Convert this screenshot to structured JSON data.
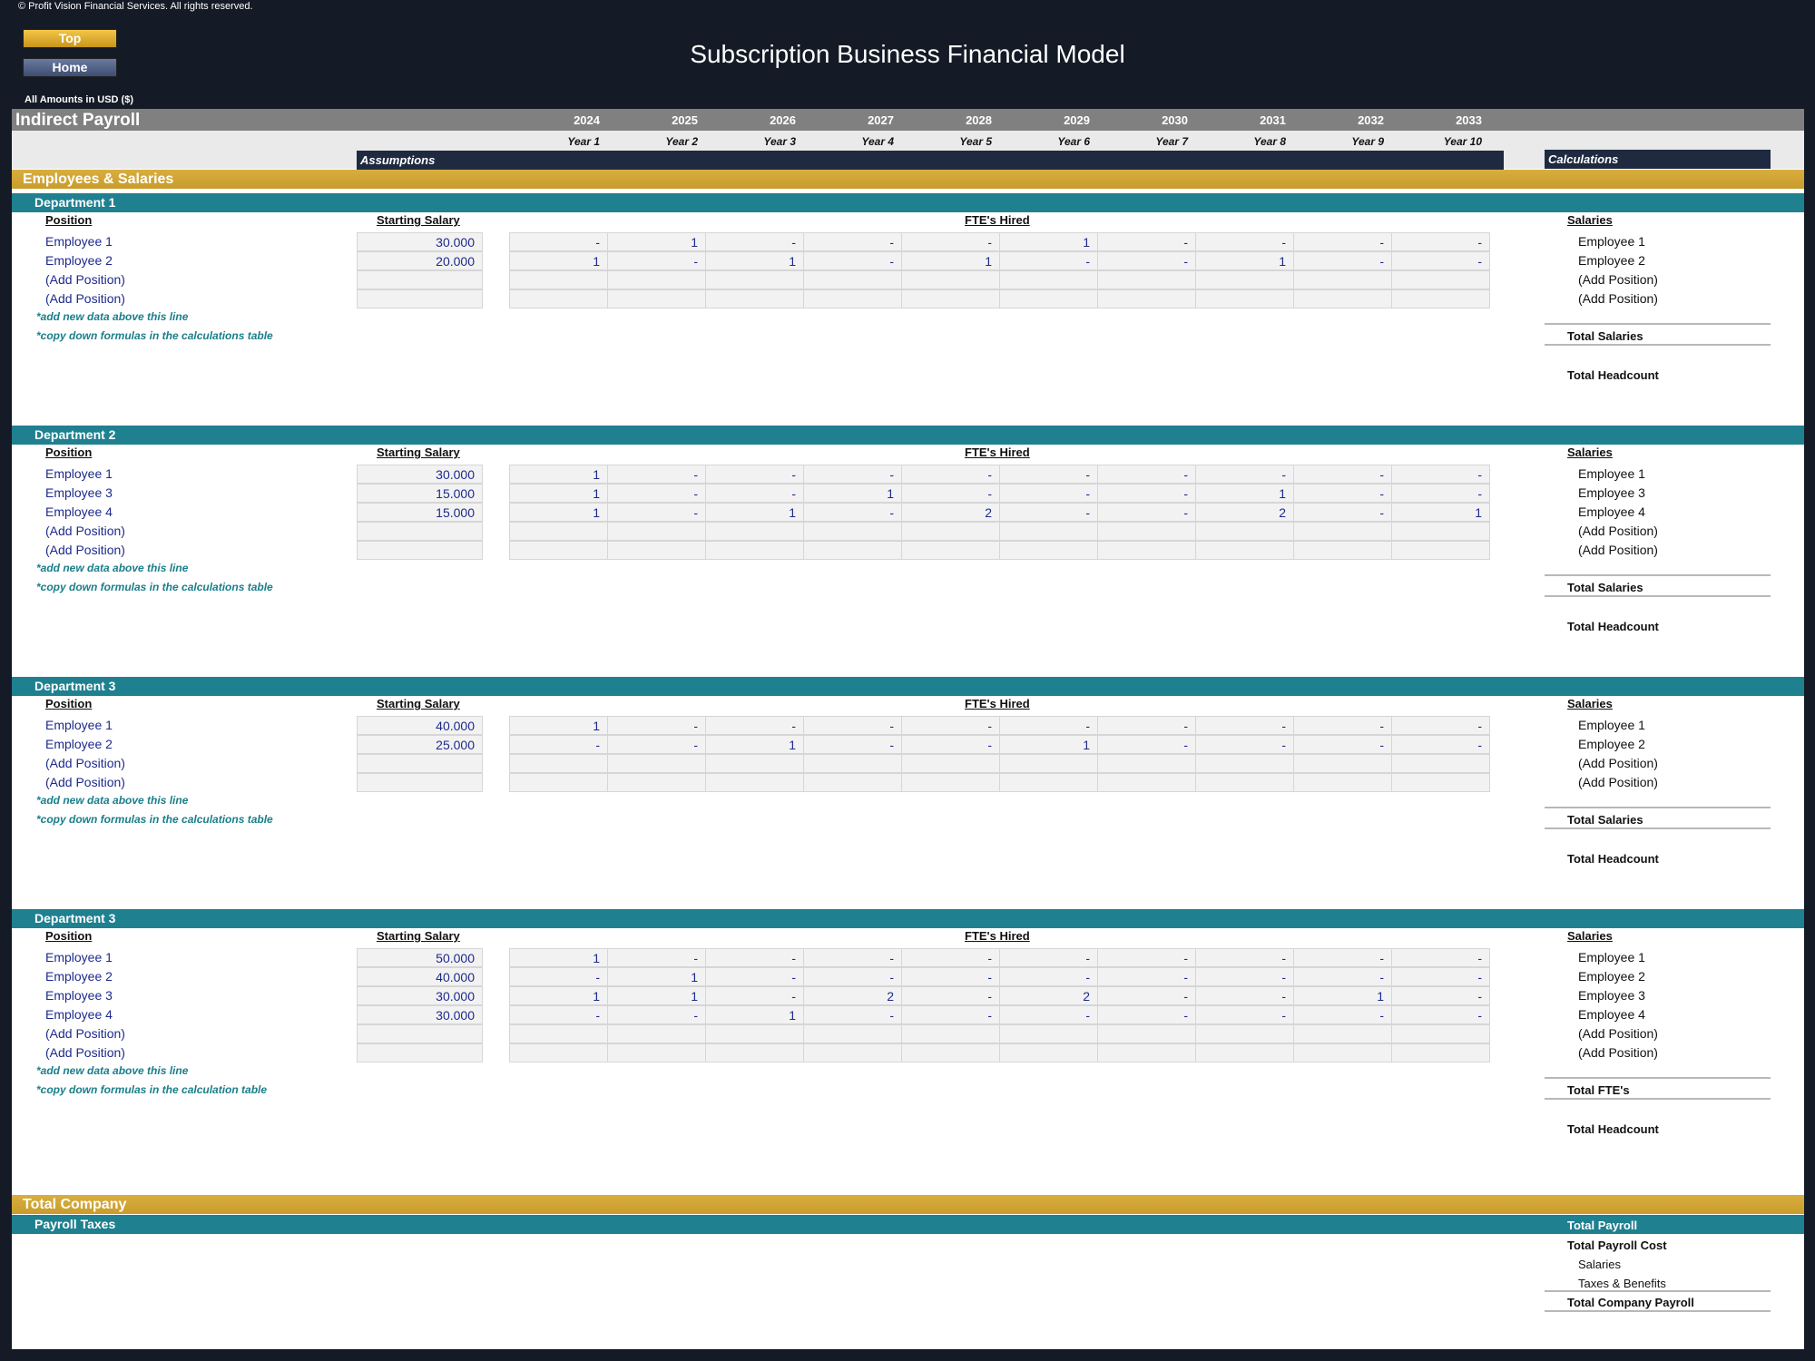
{
  "header": {
    "copyright": "© Profit Vision Financial Services. All rights reserved.",
    "top_button": "Top",
    "home_button": "Home",
    "title": "Subscription Business Financial Model",
    "amounts_label": "All Amounts in  USD ($)"
  },
  "sheet": {
    "title": "Indirect Payroll",
    "years": [
      "2024",
      "2025",
      "2026",
      "2027",
      "2028",
      "2029",
      "2030",
      "2031",
      "2032",
      "2033"
    ],
    "year_labels": [
      "Year 1",
      "Year 2",
      "Year 3",
      "Year 4",
      "Year 5",
      "Year 6",
      "Year 7",
      "Year 8",
      "Year 9",
      "Year 10"
    ],
    "assumptions_label": "Assumptions",
    "calculations_label": "Calculations",
    "section_title": "Employees & Salaries",
    "col_position": "Position",
    "col_starting_salary": "Starting Salary",
    "col_ftes": "FTE's Hired",
    "col_salaries": "Salaries",
    "note_add": "*add new data above this line",
    "note_copy": "*copy down formulas in the calculations table",
    "note_copy_alt": "*copy down formulas in the calculation table",
    "total_salaries": "Total Salaries",
    "total_ftes": "Total FTE's",
    "total_headcount": "Total Headcount"
  },
  "departments": [
    {
      "name": "Department 1",
      "rows": [
        {
          "position": "Employee 1",
          "salary": "30.000",
          "ftes": [
            "-",
            "1",
            "-",
            "-",
            "-",
            "1",
            "-",
            "-",
            "-",
            "-"
          ]
        },
        {
          "position": "Employee 2",
          "salary": "20.000",
          "ftes": [
            "1",
            "-",
            "1",
            "-",
            "1",
            "-",
            "-",
            "1",
            "-",
            "-"
          ]
        },
        {
          "position": "(Add Position)",
          "salary": "",
          "ftes": [
            "",
            "",
            "",
            "",
            "",
            "",
            "",
            "",
            "",
            ""
          ]
        },
        {
          "position": "(Add Position)",
          "salary": "",
          "ftes": [
            "",
            "",
            "",
            "",
            "",
            "",
            "",
            "",
            "",
            ""
          ]
        }
      ],
      "total_label": "Total Salaries",
      "copy_note": "*copy down formulas in the calculations table"
    },
    {
      "name": "Department 2",
      "rows": [
        {
          "position": "Employee 1",
          "salary": "30.000",
          "ftes": [
            "1",
            "-",
            "-",
            "-",
            "-",
            "-",
            "-",
            "-",
            "-",
            "-"
          ]
        },
        {
          "position": "Employee 3",
          "salary": "15.000",
          "ftes": [
            "1",
            "-",
            "-",
            "1",
            "-",
            "-",
            "-",
            "1",
            "-",
            "-"
          ]
        },
        {
          "position": "Employee 4",
          "salary": "15.000",
          "ftes": [
            "1",
            "-",
            "1",
            "-",
            "2",
            "-",
            "-",
            "2",
            "-",
            "1"
          ]
        },
        {
          "position": "(Add Position)",
          "salary": "",
          "ftes": [
            "",
            "",
            "",
            "",
            "",
            "",
            "",
            "",
            "",
            ""
          ]
        },
        {
          "position": "(Add Position)",
          "salary": "",
          "ftes": [
            "",
            "",
            "",
            "",
            "",
            "",
            "",
            "",
            "",
            ""
          ]
        }
      ],
      "total_label": "Total Salaries",
      "copy_note": "*copy down formulas in the calculations table"
    },
    {
      "name": "Department 3",
      "rows": [
        {
          "position": "Employee 1",
          "salary": "40.000",
          "ftes": [
            "1",
            "-",
            "-",
            "-",
            "-",
            "-",
            "-",
            "-",
            "-",
            "-"
          ]
        },
        {
          "position": "Employee 2",
          "salary": "25.000",
          "ftes": [
            "-",
            "-",
            "1",
            "-",
            "-",
            "1",
            "-",
            "-",
            "-",
            "-"
          ]
        },
        {
          "position": "(Add Position)",
          "salary": "",
          "ftes": [
            "",
            "",
            "",
            "",
            "",
            "",
            "",
            "",
            "",
            ""
          ]
        },
        {
          "position": "(Add Position)",
          "salary": "",
          "ftes": [
            "",
            "",
            "",
            "",
            "",
            "",
            "",
            "",
            "",
            ""
          ]
        }
      ],
      "total_label": "Total Salaries",
      "copy_note": "*copy down formulas in the calculations table"
    },
    {
      "name": "Department 3",
      "rows": [
        {
          "position": "Employee 1",
          "salary": "50.000",
          "ftes": [
            "1",
            "-",
            "-",
            "-",
            "-",
            "-",
            "-",
            "-",
            "-",
            "-"
          ]
        },
        {
          "position": "Employee 2",
          "salary": "40.000",
          "ftes": [
            "-",
            "1",
            "-",
            "-",
            "-",
            "-",
            "-",
            "-",
            "-",
            "-"
          ]
        },
        {
          "position": "Employee 3",
          "salary": "30.000",
          "ftes": [
            "1",
            "1",
            "-",
            "2",
            "-",
            "2",
            "-",
            "-",
            "1",
            "-"
          ]
        },
        {
          "position": "Employee 4",
          "salary": "30.000",
          "ftes": [
            "-",
            "-",
            "1",
            "-",
            "-",
            "-",
            "-",
            "-",
            "-",
            "-"
          ]
        },
        {
          "position": "(Add Position)",
          "salary": "",
          "ftes": [
            "",
            "",
            "",
            "",
            "",
            "",
            "",
            "",
            "",
            ""
          ]
        },
        {
          "position": "(Add Position)",
          "salary": "",
          "ftes": [
            "",
            "",
            "",
            "",
            "",
            "",
            "",
            "",
            "",
            ""
          ]
        }
      ],
      "total_label": "Total FTE's",
      "copy_note": "*copy down formulas in the calculation table"
    }
  ],
  "total_company": {
    "title": "Total Company",
    "payroll_taxes": "Payroll Taxes",
    "total_payroll": "Total Payroll",
    "total_payroll_cost": "Total Payroll Cost",
    "salaries": "Salaries",
    "taxes_benefits": "Taxes & Benefits",
    "total_company_payroll": "Total Company Payroll"
  },
  "colors": {
    "background": "#141a26",
    "gold": "#d8ae3e",
    "teal": "#1f8090",
    "input_text": "#1e2a8c",
    "note_text": "#1a7e8a"
  }
}
